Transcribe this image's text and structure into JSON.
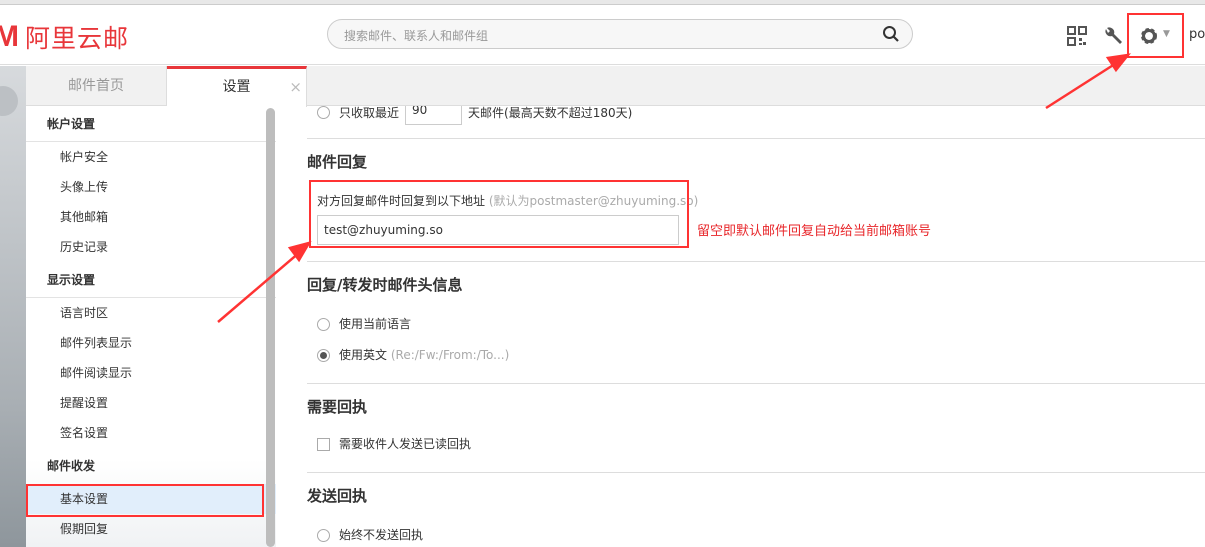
{
  "header": {
    "logo_text": "阿里云邮",
    "search_placeholder": "搜索邮件、联系人和邮件组",
    "user_partial": "po"
  },
  "tabs": [
    {
      "label": "邮件首页"
    },
    {
      "label": "设置",
      "close": "×"
    }
  ],
  "sidebar": {
    "groups": [
      {
        "title": "帐户设置",
        "items": [
          "帐户安全",
          "头像上传",
          "其他邮箱",
          "历史记录"
        ]
      },
      {
        "title": "显示设置",
        "items": [
          "语言时区",
          "邮件列表显示",
          "邮件阅读显示",
          "提醒设置",
          "签名设置"
        ]
      },
      {
        "title": "邮件收发",
        "items": [
          "基本设置",
          "假期回复"
        ]
      }
    ],
    "active": "基本设置"
  },
  "main": {
    "fetch_prefix": "只收取最近",
    "fetch_days": "90",
    "fetch_suffix": "天邮件(最高天数不超过180天)",
    "reply": {
      "title": "邮件回复",
      "label": "对方回复邮件时回复到以下地址",
      "hint": "(默认为postmaster@zhuyuming.so)",
      "value": "test@zhuyuming.so"
    },
    "header_info": {
      "title": "回复/转发时邮件头信息",
      "options": [
        "使用当前语言",
        "使用英文"
      ],
      "english_hint": "(Re:/Fw:/From:/To...)",
      "selected": 1
    },
    "receipt_req": {
      "title": "需要回执",
      "checkbox": "需要收件人发送已读回执",
      "checked": false
    },
    "send_receipt": {
      "title": "发送回执",
      "options": [
        "始终不发送回执"
      ]
    }
  },
  "annotation": {
    "note": "留空即默认邮件回复自动给当前邮箱账号",
    "color": "#e8262a"
  },
  "colors": {
    "brand": "#e8363a"
  }
}
